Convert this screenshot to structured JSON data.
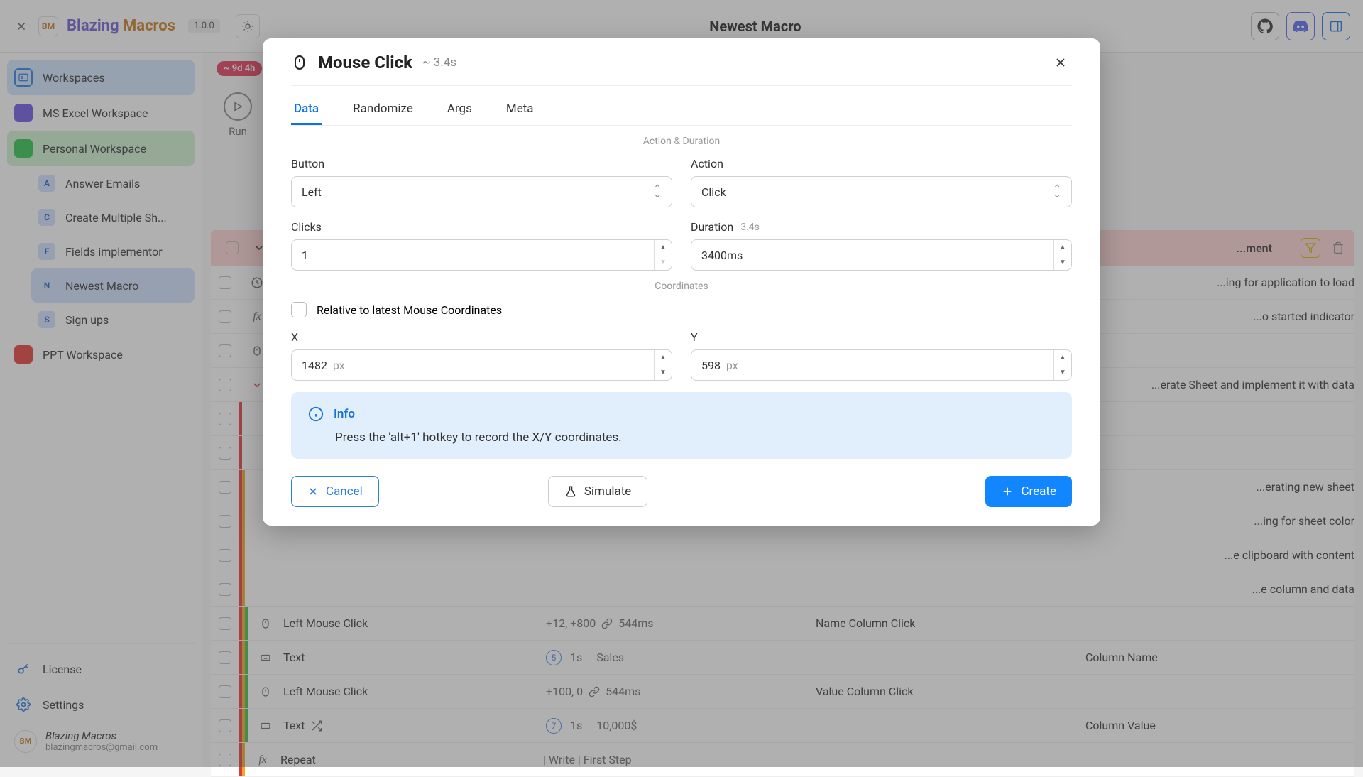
{
  "header": {
    "app_b": "Blazing",
    "app_m": "Macros",
    "version": "1.0.0",
    "page_title": "Newest Macro"
  },
  "sidebar": {
    "workspaces_label": "Workspaces",
    "ms_excel": "MS Excel Workspace",
    "personal": "Personal Workspace",
    "ppt": "PPT Workspace",
    "subs": {
      "a": "Answer Emails",
      "c": "Create Multiple Sh...",
      "f": "Fields implementor",
      "n": "Newest Macro",
      "s": "Sign ups"
    },
    "license": "License",
    "settings": "Settings",
    "user_name": "Blazing Macros",
    "user_email": "blazingmacros@gmail.com"
  },
  "work": {
    "time_badge": "~ 9d 4h",
    "run_label": "Run",
    "header_comment": "...ment"
  },
  "rows": [
    {
      "title": "",
      "data": "",
      "desc": "",
      "comment": "...ing for application to load"
    },
    {
      "title": "",
      "data": "",
      "desc": "",
      "comment": "...o started indicator"
    },
    {
      "title": "",
      "data": "",
      "desc": "",
      "comment": ""
    },
    {
      "title": "",
      "data": "",
      "desc": "",
      "comment": "...erate Sheet and implement it with data"
    },
    {
      "title": "",
      "data": "",
      "desc": "",
      "comment": ""
    },
    {
      "title": "",
      "data": "",
      "desc": "",
      "comment": ""
    },
    {
      "title": "",
      "data": "",
      "desc": "",
      "comment": "...erating new sheet"
    },
    {
      "title": "",
      "data": "",
      "desc": "",
      "comment": "...ing for sheet color"
    },
    {
      "title": "",
      "data": "",
      "desc": "",
      "comment": "...e clipboard with content"
    },
    {
      "title": "",
      "data": "",
      "desc": "",
      "comment": "...e column and data"
    },
    {
      "title": "Left Mouse Click",
      "data": "+12, +800",
      "ms": "544ms",
      "desc": "Name Column Click",
      "comment": ""
    },
    {
      "title": "Text",
      "pill": "5",
      "sec": "1s",
      "data": "Sales",
      "desc": "",
      "comment": "Column Name"
    },
    {
      "title": "Left Mouse Click",
      "data": "+100, 0",
      "ms": "544ms",
      "desc": "Value Column Click",
      "comment": ""
    },
    {
      "title": "Text",
      "pill": "7",
      "sec": "1s",
      "data": "10,000$",
      "desc": "",
      "comment": "Column Value"
    },
    {
      "title": "Repeat",
      "data": "| Write | First Step",
      "desc": "",
      "comment": ""
    }
  ],
  "modal": {
    "title": "Mouse Click",
    "sub": "~ 3.4s",
    "tabs": {
      "data": "Data",
      "randomize": "Randomize",
      "args": "Args",
      "meta": "Meta"
    },
    "section1": "Action & Duration",
    "section2": "Coordinates",
    "button_label": "Button",
    "button_value": "Left",
    "action_label": "Action",
    "action_value": "Click",
    "clicks_label": "Clicks",
    "clicks_value": "1",
    "duration_label": "Duration",
    "duration_hint": "3.4s",
    "duration_value": "3400ms",
    "relative_label": "Relative to latest Mouse Coordinates",
    "x_label": "X",
    "x_value": "1482",
    "x_unit": "px",
    "y_label": "Y",
    "y_value": "598",
    "y_unit": "px",
    "info_title": "Info",
    "info_text": "Press the 'alt+1' hotkey to record the X/Y coordinates.",
    "cancel": "Cancel",
    "simulate": "Simulate",
    "create": "Create"
  }
}
